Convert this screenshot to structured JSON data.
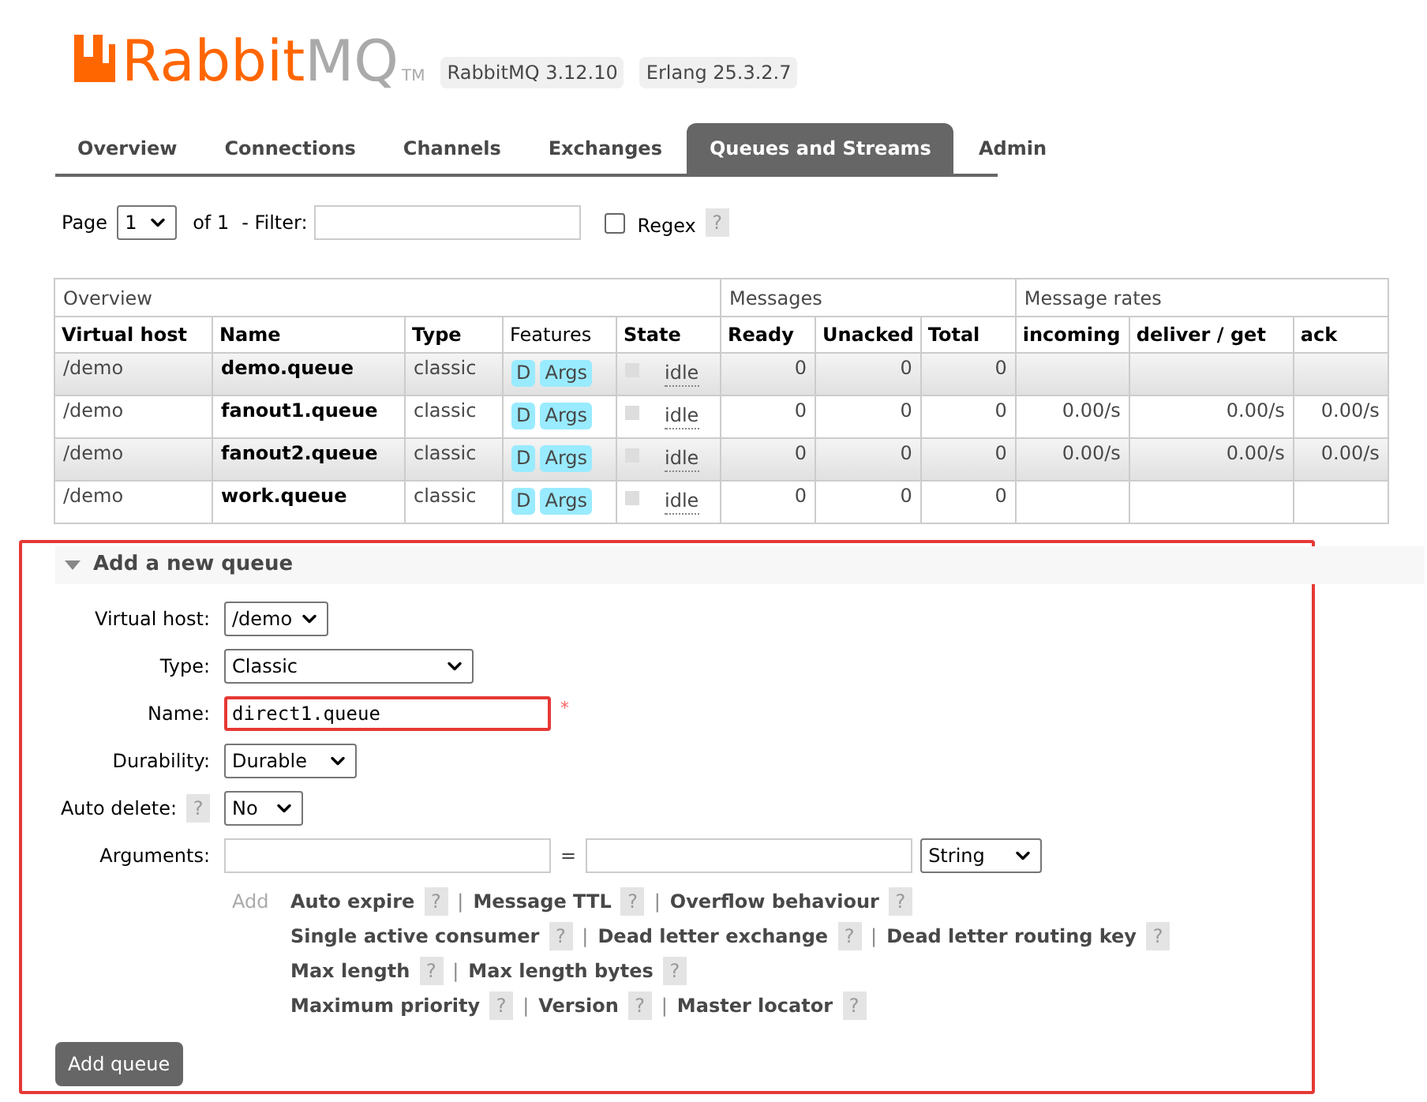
{
  "header": {
    "logo": {
      "part_1": "Rabbit",
      "part_2": "MQ",
      "trademark": "TM"
    },
    "versions": [
      "RabbitMQ 3.12.10",
      "Erlang 25.3.2.7"
    ]
  },
  "tabs": [
    {
      "label": "Overview",
      "selected": false
    },
    {
      "label": "Connections",
      "selected": false
    },
    {
      "label": "Channels",
      "selected": false
    },
    {
      "label": "Exchanges",
      "selected": false
    },
    {
      "label": "Queues and Streams",
      "selected": true
    },
    {
      "label": "Admin",
      "selected": false
    }
  ],
  "pager": {
    "page_label": "Page",
    "page": "1",
    "of_label": "of 1",
    "filter_label": "- Filter:",
    "regex_checked": false,
    "regex_label": "Regex",
    "help": "?"
  },
  "table": {
    "groups": [
      {
        "label": "Overview",
        "columns": [
          {
            "label": "Virtual host",
            "bold": true
          },
          {
            "label": "Name",
            "bold": true
          },
          {
            "label": "Type",
            "bold": true
          },
          {
            "label": "Features",
            "bold": false
          },
          {
            "label": "State",
            "bold": true
          }
        ]
      },
      {
        "label": "Messages",
        "columns": [
          {
            "label": "Ready",
            "bold": true
          },
          {
            "label": "Unacked",
            "bold": true
          },
          {
            "label": "Total",
            "bold": true
          }
        ]
      },
      {
        "label": "Message rates",
        "columns": [
          {
            "label": "incoming",
            "bold": true
          },
          {
            "label": "deliver / get",
            "bold": true
          },
          {
            "label": "ack",
            "bold": true
          }
        ]
      }
    ],
    "rows": [
      {
        "vhost": "/demo",
        "name": "demo.queue",
        "type": "classic",
        "features": [
          "D",
          "Args"
        ],
        "state": "idle",
        "ready": "0",
        "unacked": "0",
        "total": "0"
      },
      {
        "vhost": "/demo",
        "name": "fanout1.queue",
        "type": "classic",
        "features": [
          "D",
          "Args"
        ],
        "state": "idle",
        "ready": "0",
        "unacked": "0",
        "total": "0",
        "incoming": "0.00/s",
        "deliver_get": "0.00/s",
        "ack": "0.00/s"
      },
      {
        "vhost": "/demo",
        "name": "fanout2.queue",
        "type": "classic",
        "features": [
          "D",
          "Args"
        ],
        "state": "idle",
        "ready": "0",
        "unacked": "0",
        "total": "0",
        "incoming": "0.00/s",
        "deliver_get": "0.00/s",
        "ack": "0.00/s"
      },
      {
        "vhost": "/demo",
        "name": "work.queue",
        "type": "classic",
        "features": [
          "D",
          "Args"
        ],
        "state": "idle",
        "ready": "0",
        "unacked": "0",
        "total": "0"
      }
    ]
  },
  "form": {
    "title": "Add a new queue",
    "expanded": true,
    "highlighted": true,
    "fields": [
      {
        "kind": "select",
        "label": "Virtual host:",
        "value": "/demo"
      },
      {
        "kind": "select",
        "label": "Type:",
        "value": "Classic"
      },
      {
        "kind": "text",
        "label": "Name:",
        "value": "direct1.queue",
        "highlighted": true,
        "required_mark": "*"
      },
      {
        "kind": "select",
        "label": "Durability:",
        "value": "Durable"
      },
      {
        "kind": "select",
        "label": "Auto delete:",
        "help": "?",
        "value": "No"
      },
      {
        "kind": "arguments",
        "label": "Arguments:",
        "separator": "=",
        "type_value": "String"
      }
    ],
    "add_label": "Add",
    "argument_rows": [
      {
        "items": [
          {
            "label": "Auto expire",
            "help": "?",
            "separator": "|"
          },
          {
            "label": "Message TTL",
            "help": "?",
            "separator": "|"
          },
          {
            "label": "Overflow behaviour",
            "help": "?"
          }
        ]
      },
      {
        "items": [
          {
            "label": "Single active consumer",
            "help": "?",
            "separator": "|"
          },
          {
            "label": "Dead letter exchange",
            "help": "?",
            "separator": "|"
          },
          {
            "label": "Dead letter routing key",
            "help": "?"
          }
        ]
      },
      {
        "items": [
          {
            "label": "Max length",
            "help": "?",
            "separator": "|"
          },
          {
            "label": "Max length bytes",
            "help": "?"
          }
        ]
      },
      {
        "items": [
          {
            "label": "Maximum priority",
            "help": "?",
            "separator": "|"
          },
          {
            "label": "Version",
            "help": "?",
            "separator": "|"
          },
          {
            "label": "Master locator",
            "help": "?"
          }
        ]
      }
    ],
    "button": "Add queue"
  }
}
